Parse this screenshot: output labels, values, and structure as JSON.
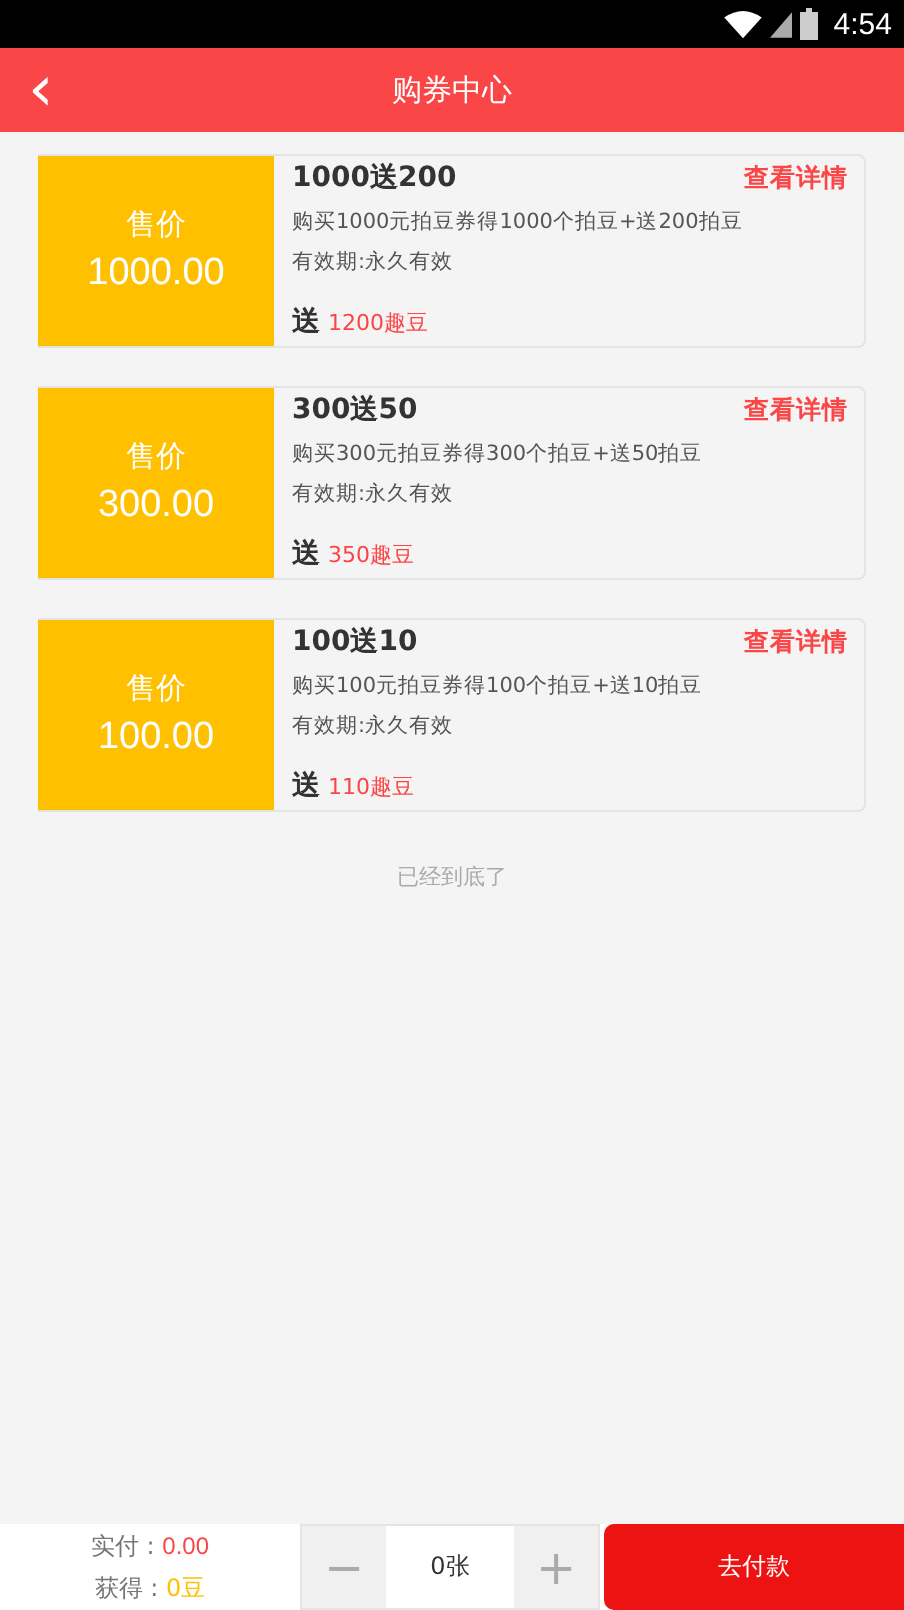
{
  "status_bar": {
    "time": "4:54"
  },
  "header": {
    "back": "‹",
    "title": "购券中心"
  },
  "coupons": [
    {
      "price_label": "售价",
      "price": "1000.00",
      "title": "1000送200",
      "detail_link": "查看详情",
      "description": "购买1000元拍豆券得1000个拍豆+送200拍豆",
      "validity": "有效期:永久有效",
      "bonus_label": "送",
      "bonus": "1200趣豆"
    },
    {
      "price_label": "售价",
      "price": "300.00",
      "title": "300送50",
      "detail_link": "查看详情",
      "description": "购买300元拍豆券得300个拍豆+送50拍豆",
      "validity": "有效期:永久有效",
      "bonus_label": "送",
      "bonus": "350趣豆"
    },
    {
      "price_label": "售价",
      "price": "100.00",
      "title": "100送10",
      "detail_link": "查看详情",
      "description": "购买100元拍豆券得100个拍豆+送10拍豆",
      "validity": "有效期:永久有效",
      "bonus_label": "送",
      "bonus": "110趣豆"
    }
  ],
  "end_note": "已经到底了",
  "footer": {
    "paid_label": "实付 : ",
    "paid": "0.00",
    "earned_label": "获得 : ",
    "earned": "0豆",
    "minus": "−",
    "quantity": "0张",
    "plus": "+",
    "pay_button": "去付款"
  }
}
